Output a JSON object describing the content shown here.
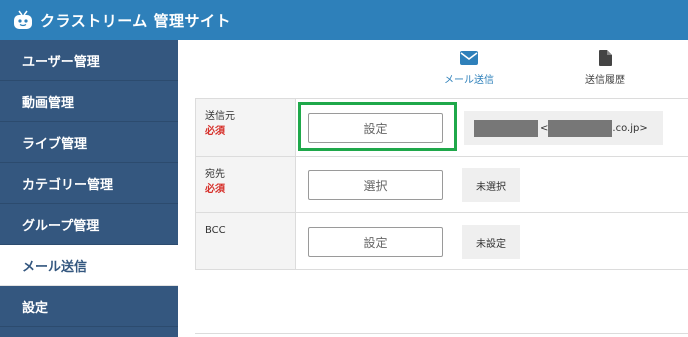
{
  "header": {
    "title": "クラストリーム 管理サイト",
    "bg_color": "#2e80ba",
    "logo_icon": "tv-robot-icon"
  },
  "sidebar": {
    "bg_color": "#34577f",
    "items": [
      {
        "label": "ユーザー管理",
        "active": false
      },
      {
        "label": "動画管理",
        "active": false
      },
      {
        "label": "ライブ管理",
        "active": false
      },
      {
        "label": "カテゴリー管理",
        "active": false
      },
      {
        "label": "グループ管理",
        "active": false
      },
      {
        "label": "メール送信",
        "active": true
      },
      {
        "label": "設定",
        "active": false
      }
    ]
  },
  "tabs": [
    {
      "label": "メール送信",
      "icon": "envelope-icon",
      "active": true
    },
    {
      "label": "送信履歴",
      "icon": "document-icon",
      "active": false
    }
  ],
  "form": {
    "rows": [
      {
        "label": "送信元",
        "required": "必須",
        "button": "設定",
        "status": "<___.co.jp>",
        "status_suffix": ".co.jp>"
      },
      {
        "label": "宛先",
        "required": "必須",
        "button": "選択",
        "status": "未選択"
      },
      {
        "label": "BCC",
        "required": "",
        "button": "設定",
        "status": "未設定"
      }
    ]
  },
  "highlight_color": "#1fa84a"
}
